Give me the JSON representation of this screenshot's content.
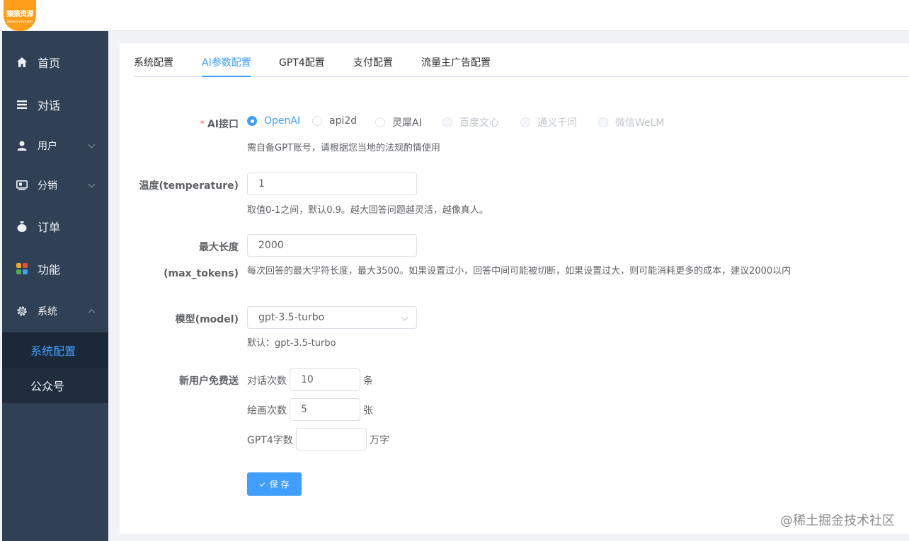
{
  "logo": {
    "text": "猿猿资源",
    "sub": "www.yyzy.com"
  },
  "sidebar": {
    "items": [
      {
        "label": "首页",
        "icon": "home-icon"
      },
      {
        "label": "对话",
        "icon": "menu-icon"
      },
      {
        "label": "用户",
        "icon": "user-icon",
        "expandable": true
      },
      {
        "label": "分销",
        "icon": "distribution-icon",
        "expandable": true
      },
      {
        "label": "订单",
        "icon": "money-bag-icon"
      },
      {
        "label": "功能",
        "icon": "apps-icon"
      },
      {
        "label": "系统",
        "icon": "gear-icon",
        "expanded": true
      }
    ],
    "submenu": [
      {
        "label": "系统配置",
        "active": true
      },
      {
        "label": "公众号",
        "active": false
      }
    ]
  },
  "tabs": [
    {
      "label": "系统配置"
    },
    {
      "label": "AI参数配置",
      "active": true
    },
    {
      "label": "GPT4配置"
    },
    {
      "label": "支付配置"
    },
    {
      "label": "流量主广告配置"
    }
  ],
  "form": {
    "ai_interface": {
      "label": "AI接口",
      "required_mark": "*",
      "options": [
        {
          "label": "OpenAI",
          "state": "checked"
        },
        {
          "label": "api2d",
          "state": "normal"
        },
        {
          "label": "灵犀AI",
          "state": "normal"
        },
        {
          "label": "百度文心",
          "state": "disabled"
        },
        {
          "label": "通义千问",
          "state": "disabled"
        },
        {
          "label": "微信WeLM",
          "state": "disabled"
        }
      ],
      "help": "需自备GPT账号，请根据您当地的法规酌情使用"
    },
    "temperature": {
      "label": "温度(temperature)",
      "value": "1",
      "help": "取值0-1之间，默认0.9。越大回答问题越灵活，越像真人。"
    },
    "max_tokens": {
      "label_line1": "最大长度",
      "label_line2": "(max_tokens)",
      "value": "2000",
      "help": "每次回答的最大字符长度，最大3500。如果设置过小，回答中间可能被切断，如果设置过大，则可能消耗更多的成本，建议2000以内"
    },
    "model": {
      "label": "模型(model)",
      "value": "gpt-3.5-turbo",
      "help": "默认：gpt-3.5-turbo"
    },
    "free_gift": {
      "label": "新用户免费送",
      "chat_label": "对话次数",
      "chat_value": "10",
      "chat_unit": "条",
      "draw_label": "绘画次数",
      "draw_value": "5",
      "draw_unit": "张",
      "gpt4_label": "GPT4字数",
      "gpt4_value": "",
      "gpt4_unit": "万字"
    },
    "save_label": "保 存"
  },
  "watermark": "@稀土掘金技术社区"
}
